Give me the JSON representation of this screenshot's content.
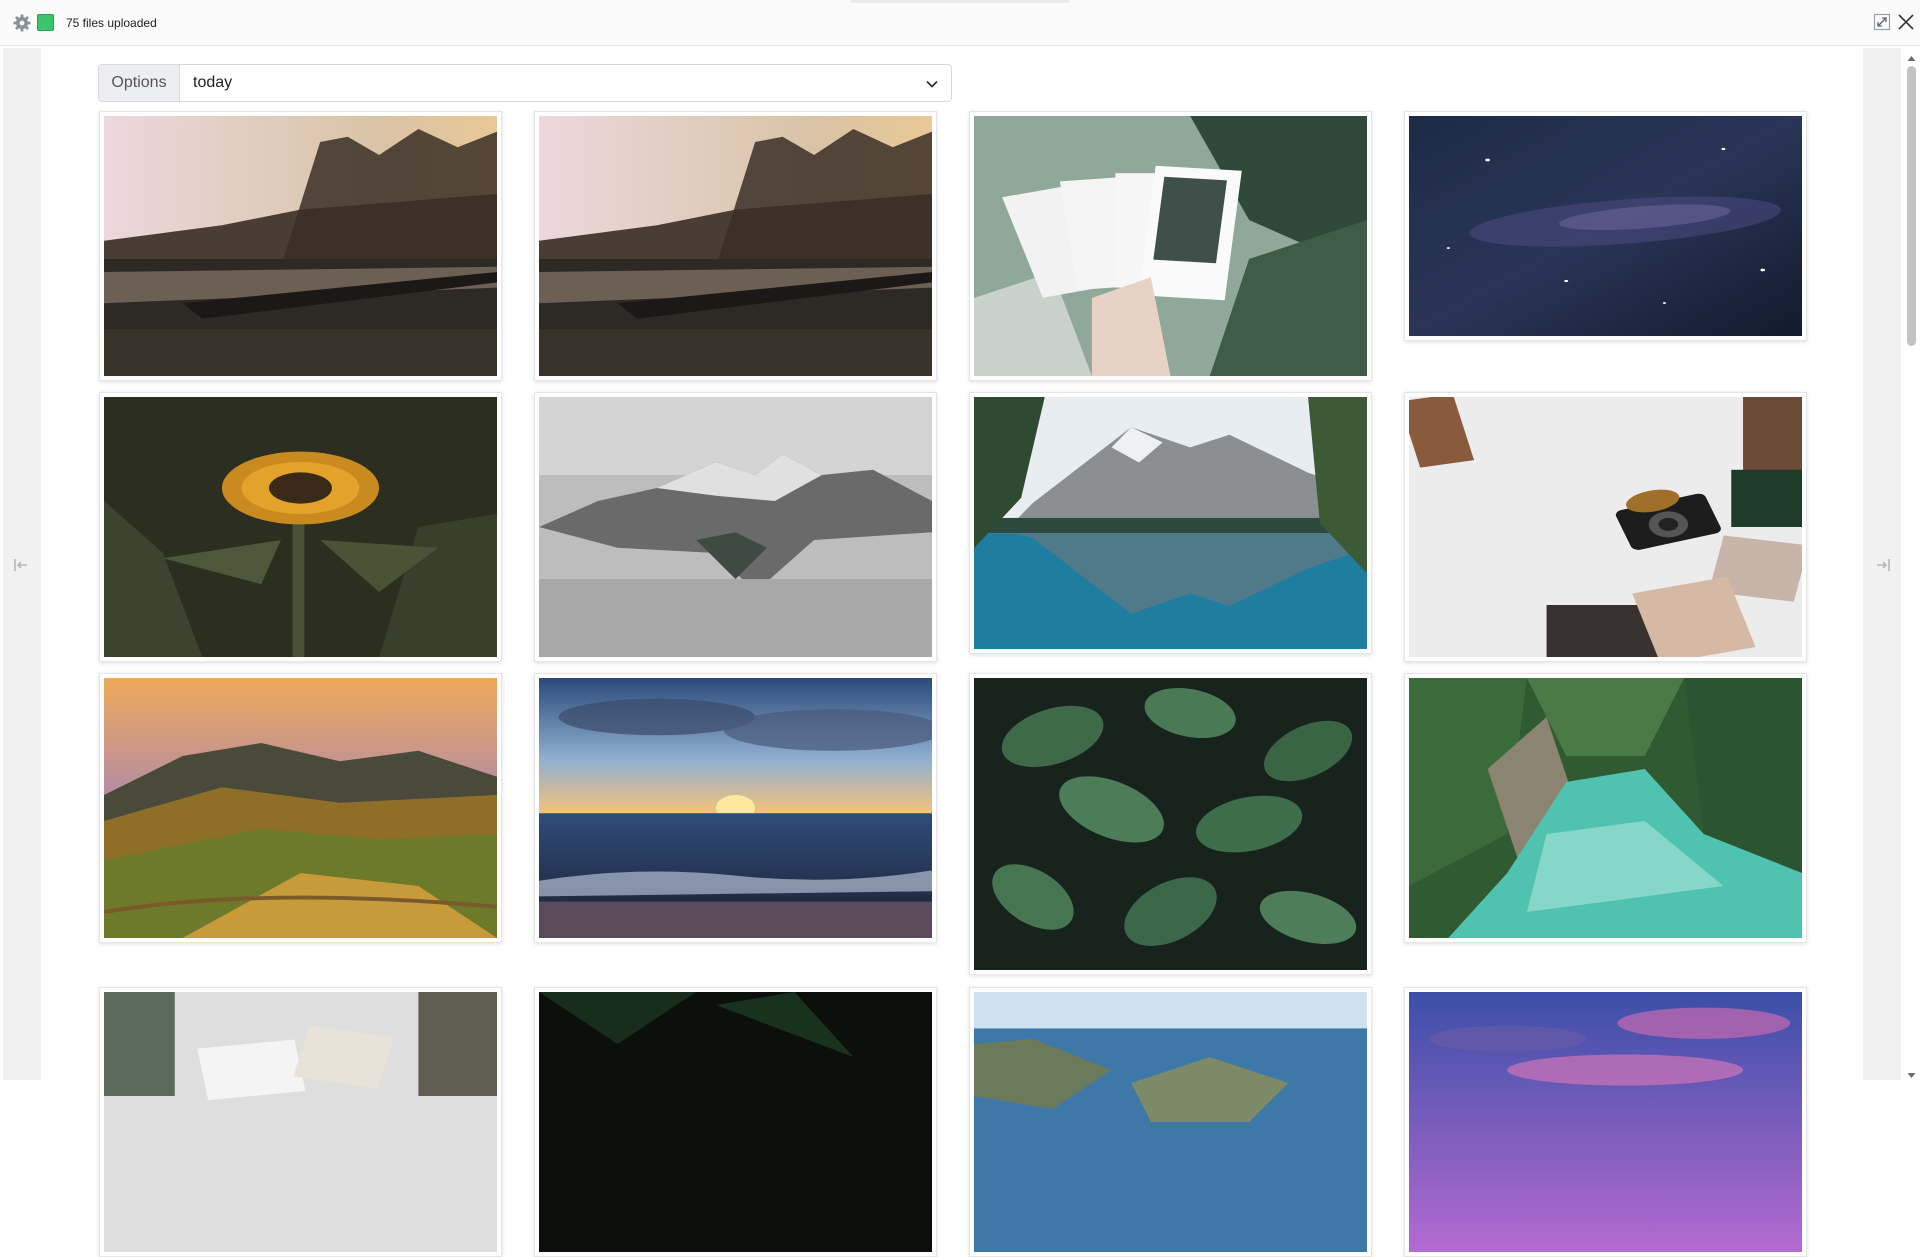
{
  "window": {
    "title": "75 files uploaded",
    "status_color": "#3cc46b",
    "icons": {
      "settings": "gear-icon",
      "expand": "expand-icon",
      "close": "close-icon",
      "collapse_left": "collapse-left-icon",
      "collapse_right": "collapse-right-icon"
    }
  },
  "filter": {
    "label": "Options",
    "selected": "today",
    "icon": "chevron-down-icon"
  },
  "gallery": {
    "photos": [
      {
        "name": "railroad-autumn-forest-photo"
      },
      {
        "name": "railroad-autumn-forest-photo"
      },
      {
        "name": "polaroids-among-leaves-photo"
      },
      {
        "name": "milky-way-night-sky-photo"
      },
      {
        "name": "sunflower-photo"
      },
      {
        "name": "misty-mountain-peaks-photo"
      },
      {
        "name": "mountain-lake-reflection-photo"
      },
      {
        "name": "vintage-camera-and-photos-photo"
      },
      {
        "name": "vineyard-hills-sunset-photo"
      },
      {
        "name": "ocean-sunset-beach-photo"
      },
      {
        "name": "green-leaves-with-raindrops-photo"
      },
      {
        "name": "turquoise-river-forest-photo"
      },
      {
        "name": "photos-on-desk-photo"
      },
      {
        "name": "dark-night-sky-photo"
      },
      {
        "name": "coastal-cliffs-sea-photo"
      },
      {
        "name": "purple-sunset-clouds-photo"
      }
    ]
  }
}
